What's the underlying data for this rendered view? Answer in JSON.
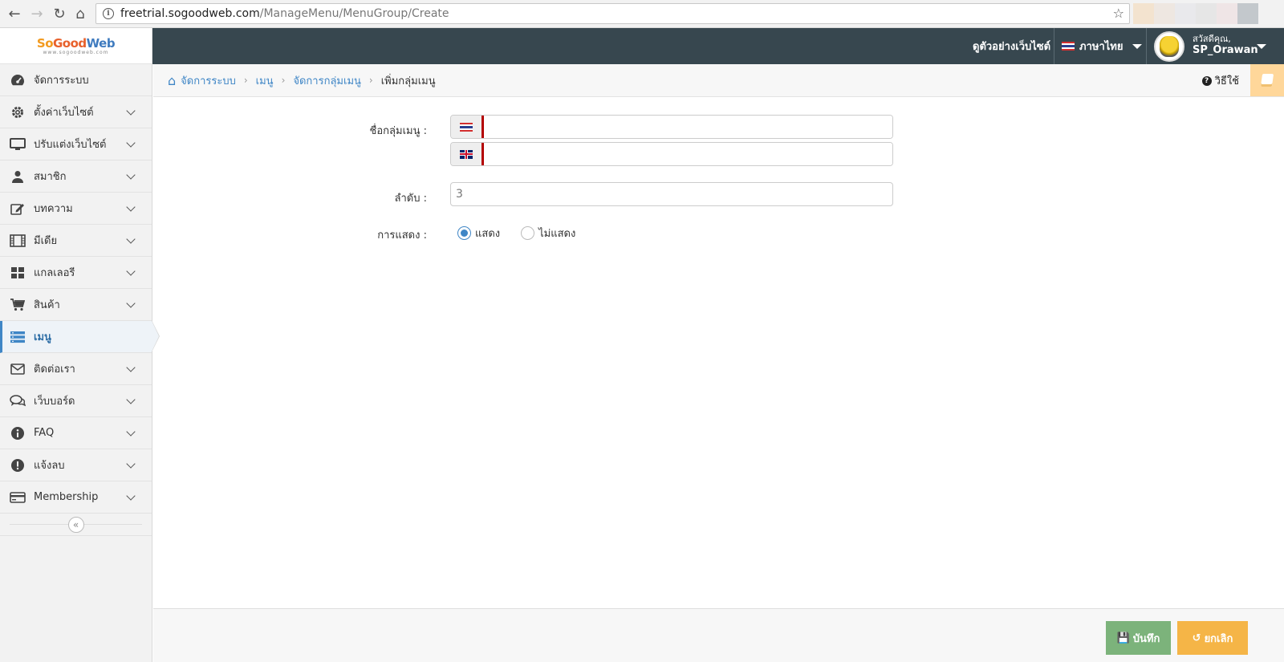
{
  "browser": {
    "url_host": "freetrial.sogoodweb.com",
    "url_path": "/ManageMenu/MenuGroup/Create"
  },
  "brand": {
    "logo_so": "So",
    "logo_good": "Good",
    "logo_web": "Web",
    "logo_sub": "www.sogoodweb.com",
    "colors": {
      "header_bg": "#37474f",
      "accent": "#3f86c6",
      "save": "#7cb37b",
      "cancel": "#f5b547"
    }
  },
  "header": {
    "view_site": "ดูตัวอย่างเว็บไซต์",
    "language": "ภาษาไทย",
    "greeting": "สวัสดีคุณ,",
    "username": "SP_Orawan"
  },
  "sidebar": {
    "items": [
      {
        "label": "จัดการระบบ",
        "icon": "dashboard-icon"
      },
      {
        "label": "ตั้งค่าเว็บไซต์",
        "icon": "gear-icon"
      },
      {
        "label": "ปรับแต่งเว็บไซต์",
        "icon": "monitor-icon"
      },
      {
        "label": "สมาชิก",
        "icon": "user-icon"
      },
      {
        "label": "บทความ",
        "icon": "edit-icon"
      },
      {
        "label": "มีเดีย",
        "icon": "film-icon"
      },
      {
        "label": "แกลเลอรี",
        "icon": "grid-icon"
      },
      {
        "label": "สินค้า",
        "icon": "cart-icon"
      },
      {
        "label": "เมนู",
        "icon": "menu-icon"
      },
      {
        "label": "ติดต่อเรา",
        "icon": "envelope-icon"
      },
      {
        "label": "เว็บบอร์ด",
        "icon": "chat-icon"
      },
      {
        "label": "FAQ",
        "icon": "info-icon"
      },
      {
        "label": "แจ้งลบ",
        "icon": "exclamation-icon"
      },
      {
        "label": "Membership",
        "icon": "card-icon"
      }
    ]
  },
  "breadcrumb": {
    "home": "จัดการระบบ",
    "level1": "เมนู",
    "level2": "จัดการกลุ่มเมนู",
    "current": "เพิ่มกลุ่มเมนู"
  },
  "help": {
    "label": "วิธีใช้"
  },
  "form": {
    "name_label": "ชื่อกลุ่มเมนู :",
    "name_th_value": "",
    "name_en_value": "",
    "order_label": "ลำดับ :",
    "order_value": "3",
    "display_label": "การแสดง :",
    "display_options": [
      "แสดง",
      "ไม่แสดง"
    ],
    "display_selected": "แสดง"
  },
  "footer": {
    "save_label": "บันทึก",
    "cancel_label": "ยกเลิก"
  }
}
